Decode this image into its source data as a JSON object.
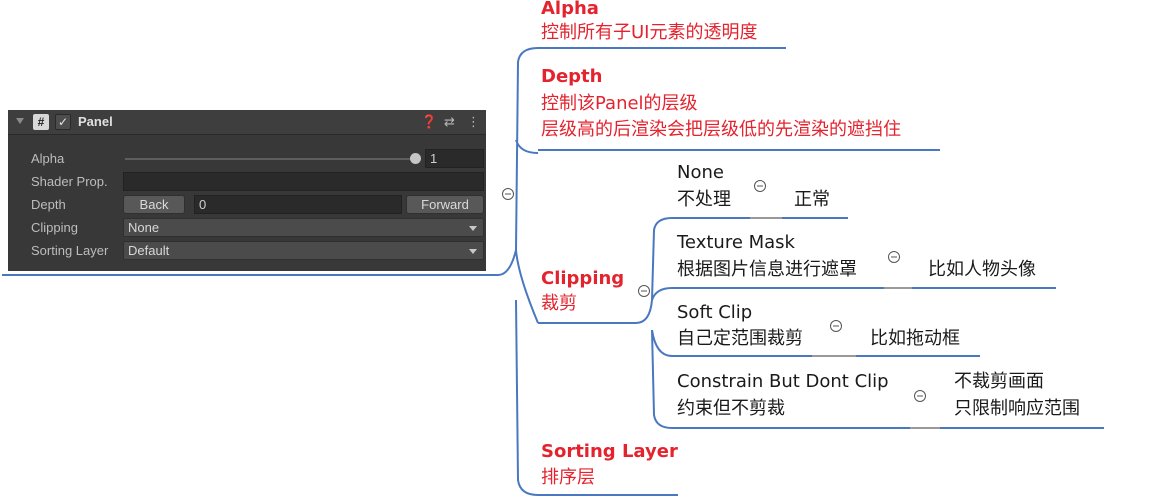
{
  "colors": {
    "accent_red": "#e4232e",
    "line_blue": "#4a78c0",
    "panel_bg": "#383838"
  },
  "panel": {
    "title": "Panel",
    "icons": [
      "help-icon",
      "preset-icon",
      "more-icon"
    ],
    "alpha": {
      "label": "Alpha",
      "value": "1",
      "slider_fraction": 1.0
    },
    "shader_prop": {
      "label": "Shader Prop.",
      "value": ""
    },
    "depth": {
      "label": "Depth",
      "back": "Back",
      "value": "0",
      "forward": "Forward"
    },
    "clipping": {
      "label": "Clipping",
      "value": "None"
    },
    "sorting_layer": {
      "label": "Sorting Layer",
      "value": "Default"
    }
  },
  "mindmap": {
    "alpha": {
      "title": "Alpha",
      "desc": "控制所有子UI元素的透明度"
    },
    "depth": {
      "title": "Depth",
      "desc1": "控制该Panel的层级",
      "desc2": "层级高的后渲染会把层级低的先渲染的遮挡住"
    },
    "clipping": {
      "title": "Clipping",
      "desc": "裁剪",
      "options": [
        {
          "name": "None",
          "desc": "不处理",
          "note": "正常"
        },
        {
          "name": "Texture Mask",
          "desc": "根据图片信息进行遮罩",
          "note": "比如人物头像"
        },
        {
          "name": "Soft Clip",
          "desc": "自己定范围裁剪",
          "note": "比如拖动框"
        },
        {
          "name": "Constrain But Dont Clip",
          "desc": "约束但不剪裁",
          "note1": "不裁剪画面",
          "note2": "只限制响应范围"
        }
      ]
    },
    "sorting_layer": {
      "title": "Sorting Layer",
      "desc": "排序层"
    },
    "collapse_symbol": "−"
  }
}
